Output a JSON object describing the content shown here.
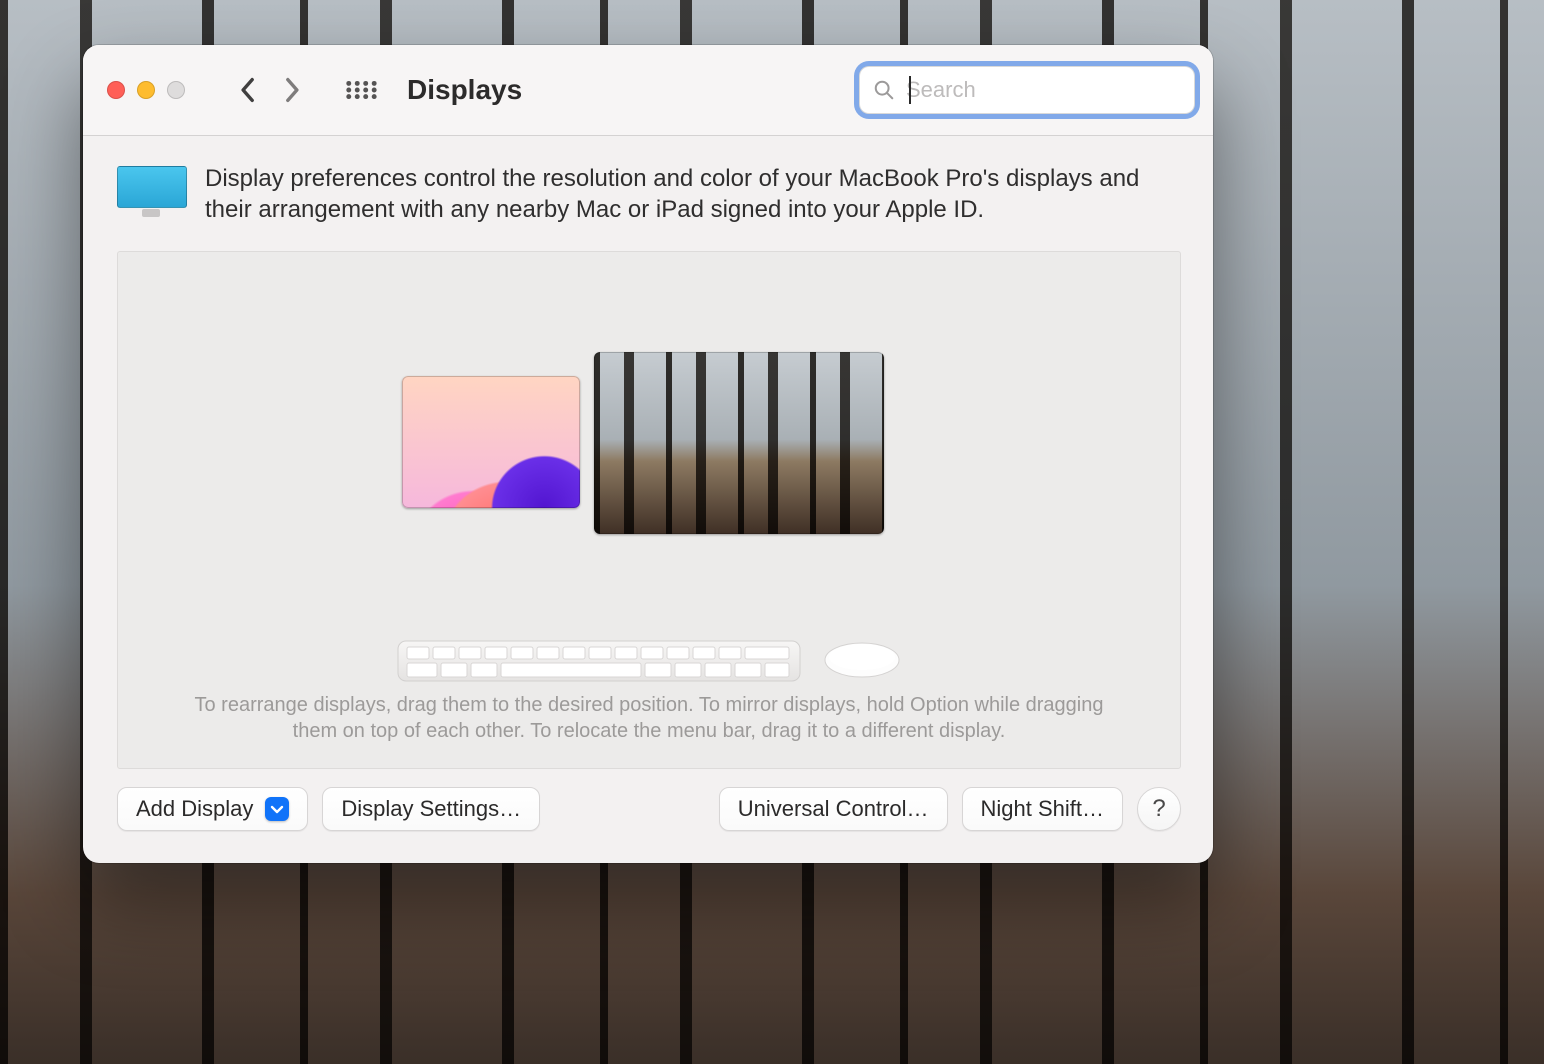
{
  "window": {
    "title": "Displays",
    "search": {
      "placeholder": "Search",
      "value": ""
    }
  },
  "intro": {
    "text": "Display preferences control the resolution and color of your MacBook Pro's displays and their arrangement with any nearby Mac or iPad signed into your Apple ID."
  },
  "arrangement": {
    "hint": "To rearrange displays, drag them to the desired position. To mirror displays, hold Option while dragging them on top of each other. To relocate the menu bar, drag it to a different display."
  },
  "buttons": {
    "add_display": "Add Display",
    "display_settings": "Display Settings…",
    "universal_control": "Universal Control…",
    "night_shift": "Night Shift…",
    "help": "?"
  }
}
